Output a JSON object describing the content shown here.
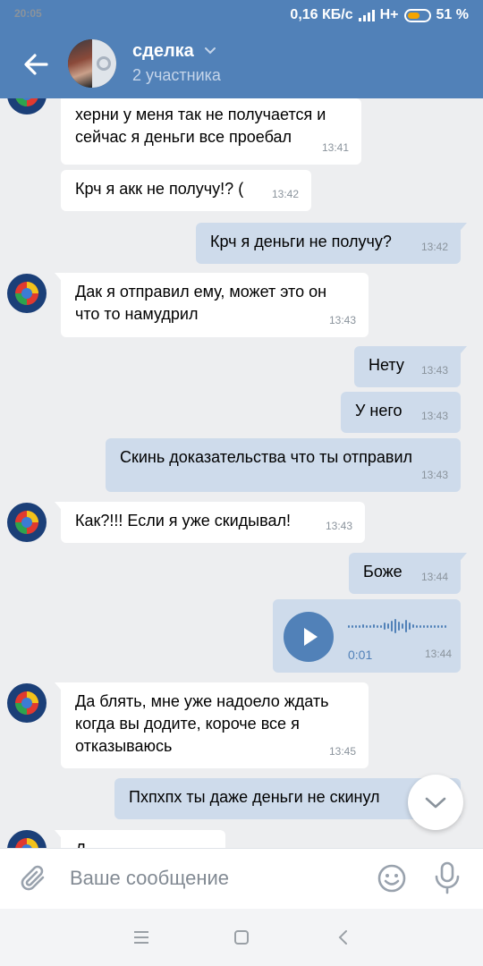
{
  "status_bar": {
    "time": "20:05",
    "speed": "0,16 КБ/с",
    "network": "H+",
    "battery": "51 %"
  },
  "header": {
    "title": "сделка",
    "subtitle": "2 участника"
  },
  "messages": [
    {
      "dir": "in",
      "lines": [
        "херни у меня так не получается и",
        "сейчас я деньги все проебал"
      ],
      "time": "13:41"
    },
    {
      "dir": "in",
      "lines": [
        "Крч я акк не получу!? ("
      ],
      "time": "13:42"
    },
    {
      "dir": "out",
      "lines": [
        "Крч я деньги не получу?"
      ],
      "time": "13:42"
    },
    {
      "dir": "in",
      "lines": [
        "Дак я отправил ему, может это он",
        "что то намудрил"
      ],
      "time": "13:43"
    },
    {
      "dir": "out",
      "lines": [
        "Нету"
      ],
      "time": "13:43"
    },
    {
      "dir": "out",
      "lines": [
        "У него"
      ],
      "time": "13:43"
    },
    {
      "dir": "out",
      "lines": [
        "Скинь доказательства что ты отправил"
      ],
      "time": "13:43"
    },
    {
      "dir": "in",
      "lines": [
        "Как?!!! Если я уже скидывал!"
      ],
      "time": "13:43"
    },
    {
      "dir": "out",
      "lines": [
        "Боже"
      ],
      "time": "13:44"
    },
    {
      "dir": "out",
      "type": "voice",
      "duration": "0:01",
      "time": "13:44"
    },
    {
      "dir": "in",
      "lines": [
        "Да блять, мне уже надоело ждать",
        "когда вы додите, короче все я",
        "отказываюсь"
      ],
      "time": "13:45"
    },
    {
      "dir": "out",
      "lines": [
        "Пхпхпх ты даже деньги не скинул"
      ],
      "time": ""
    },
    {
      "dir": "in",
      "lines": [
        "Д"
      ],
      "time": ""
    }
  ],
  "composer": {
    "placeholder": "Ваше сообщение"
  },
  "colors": {
    "brand": "#5181b8",
    "outgoing_bubble": "#cedbeb",
    "incoming_bubble": "#ffffff",
    "background": "#edeef0"
  },
  "icons": [
    "back-arrow-icon",
    "chevron-down-icon",
    "play-icon",
    "scroll-down-icon",
    "attach-icon",
    "smile-icon",
    "mic-icon",
    "menu-icon",
    "home-icon",
    "back-icon"
  ]
}
